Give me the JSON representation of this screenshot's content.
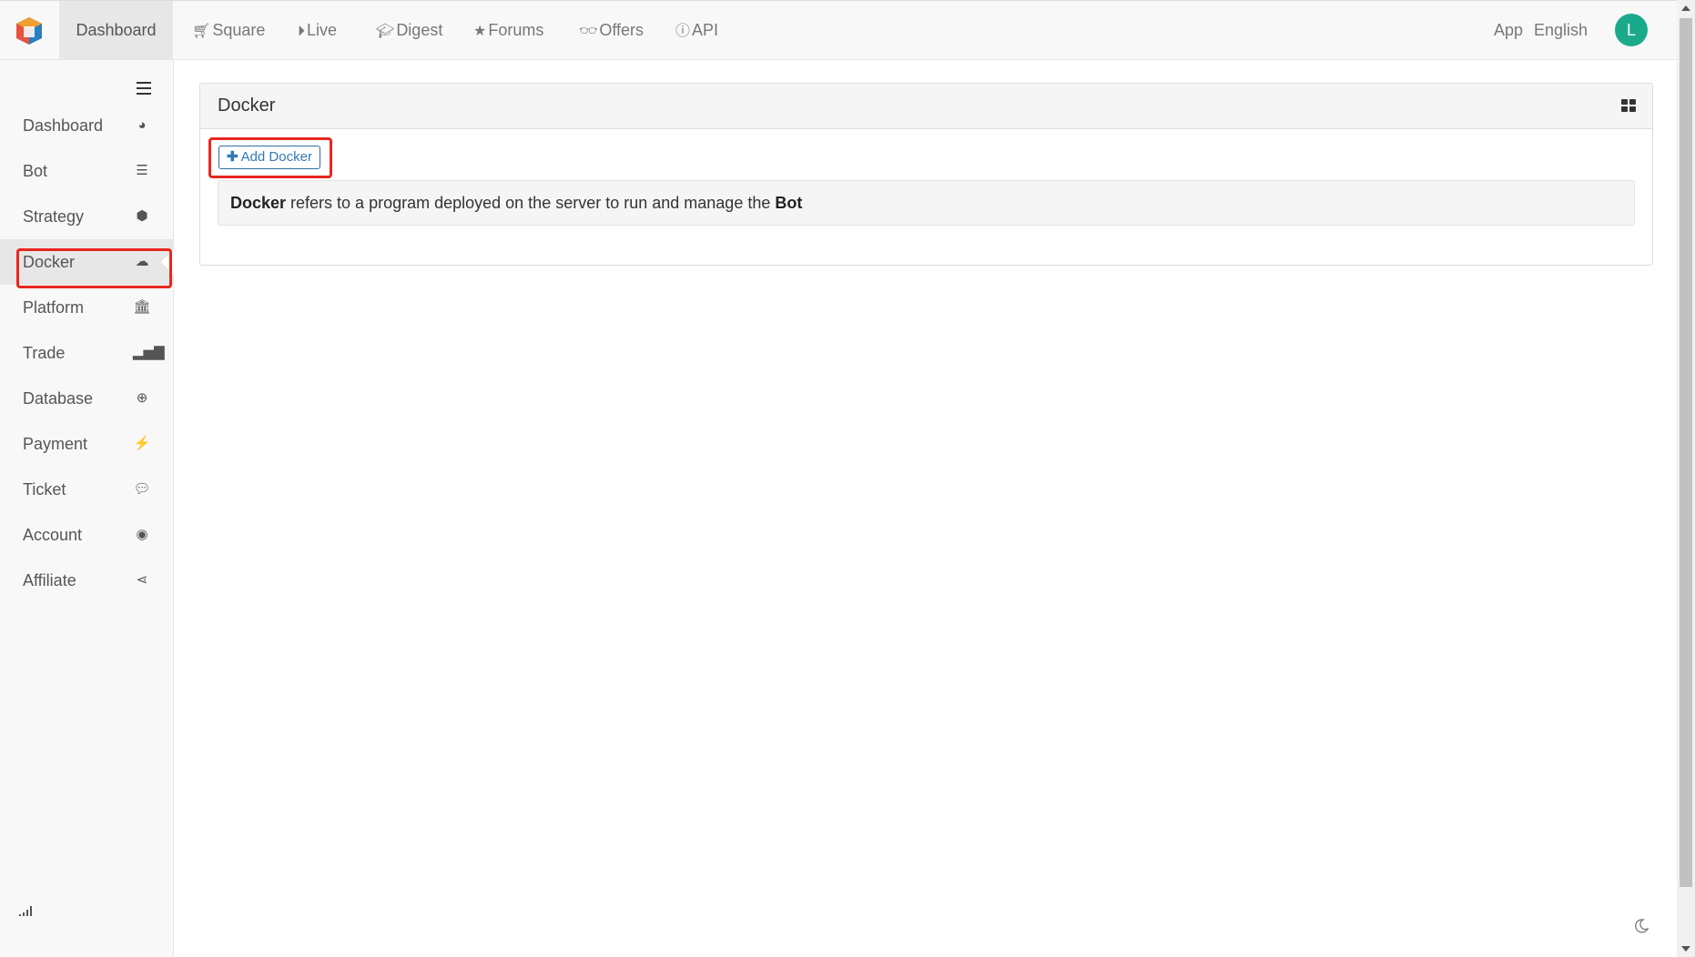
{
  "topnav": {
    "home": "Dashboard",
    "items": [
      {
        "label": "Square",
        "icon": "cart-icon"
      },
      {
        "label": "Live",
        "icon": "play-circle-icon"
      },
      {
        "label": "Digest",
        "icon": "graduation-cap-icon"
      },
      {
        "label": "Forums",
        "icon": "star-icon"
      },
      {
        "label": "Offers",
        "icon": "glasses-icon"
      },
      {
        "label": "API",
        "icon": "info-circle-icon"
      }
    ],
    "app": "App",
    "language": "English",
    "avatar_letter": "L",
    "avatar_color": "#1aaa8b"
  },
  "sidebar": {
    "items": [
      {
        "label": "Dashboard",
        "icon": "palette-icon"
      },
      {
        "label": "Bot",
        "icon": "server-icon"
      },
      {
        "label": "Strategy",
        "icon": "cube-icon"
      },
      {
        "label": "Docker",
        "icon": "cloud-icon"
      },
      {
        "label": "Platform",
        "icon": "bank-icon"
      },
      {
        "label": "Trade",
        "icon": "bar-chart-icon"
      },
      {
        "label": "Database",
        "icon": "search-plus-icon"
      },
      {
        "label": "Payment",
        "icon": "plug-icon"
      },
      {
        "label": "Ticket",
        "icon": "comment-icon"
      },
      {
        "label": "Account",
        "icon": "user-circle-icon"
      },
      {
        "label": "Affiliate",
        "icon": "share-icon"
      }
    ],
    "active": "Docker"
  },
  "panel": {
    "title": "Docker",
    "add_button": "Add Docker",
    "info": {
      "term": "Docker",
      "text": " refers to a program deployed on the server to run and manage the ",
      "target": "Bot"
    }
  },
  "colors": {
    "highlight": "#e8261f",
    "link": "#337ab7"
  }
}
